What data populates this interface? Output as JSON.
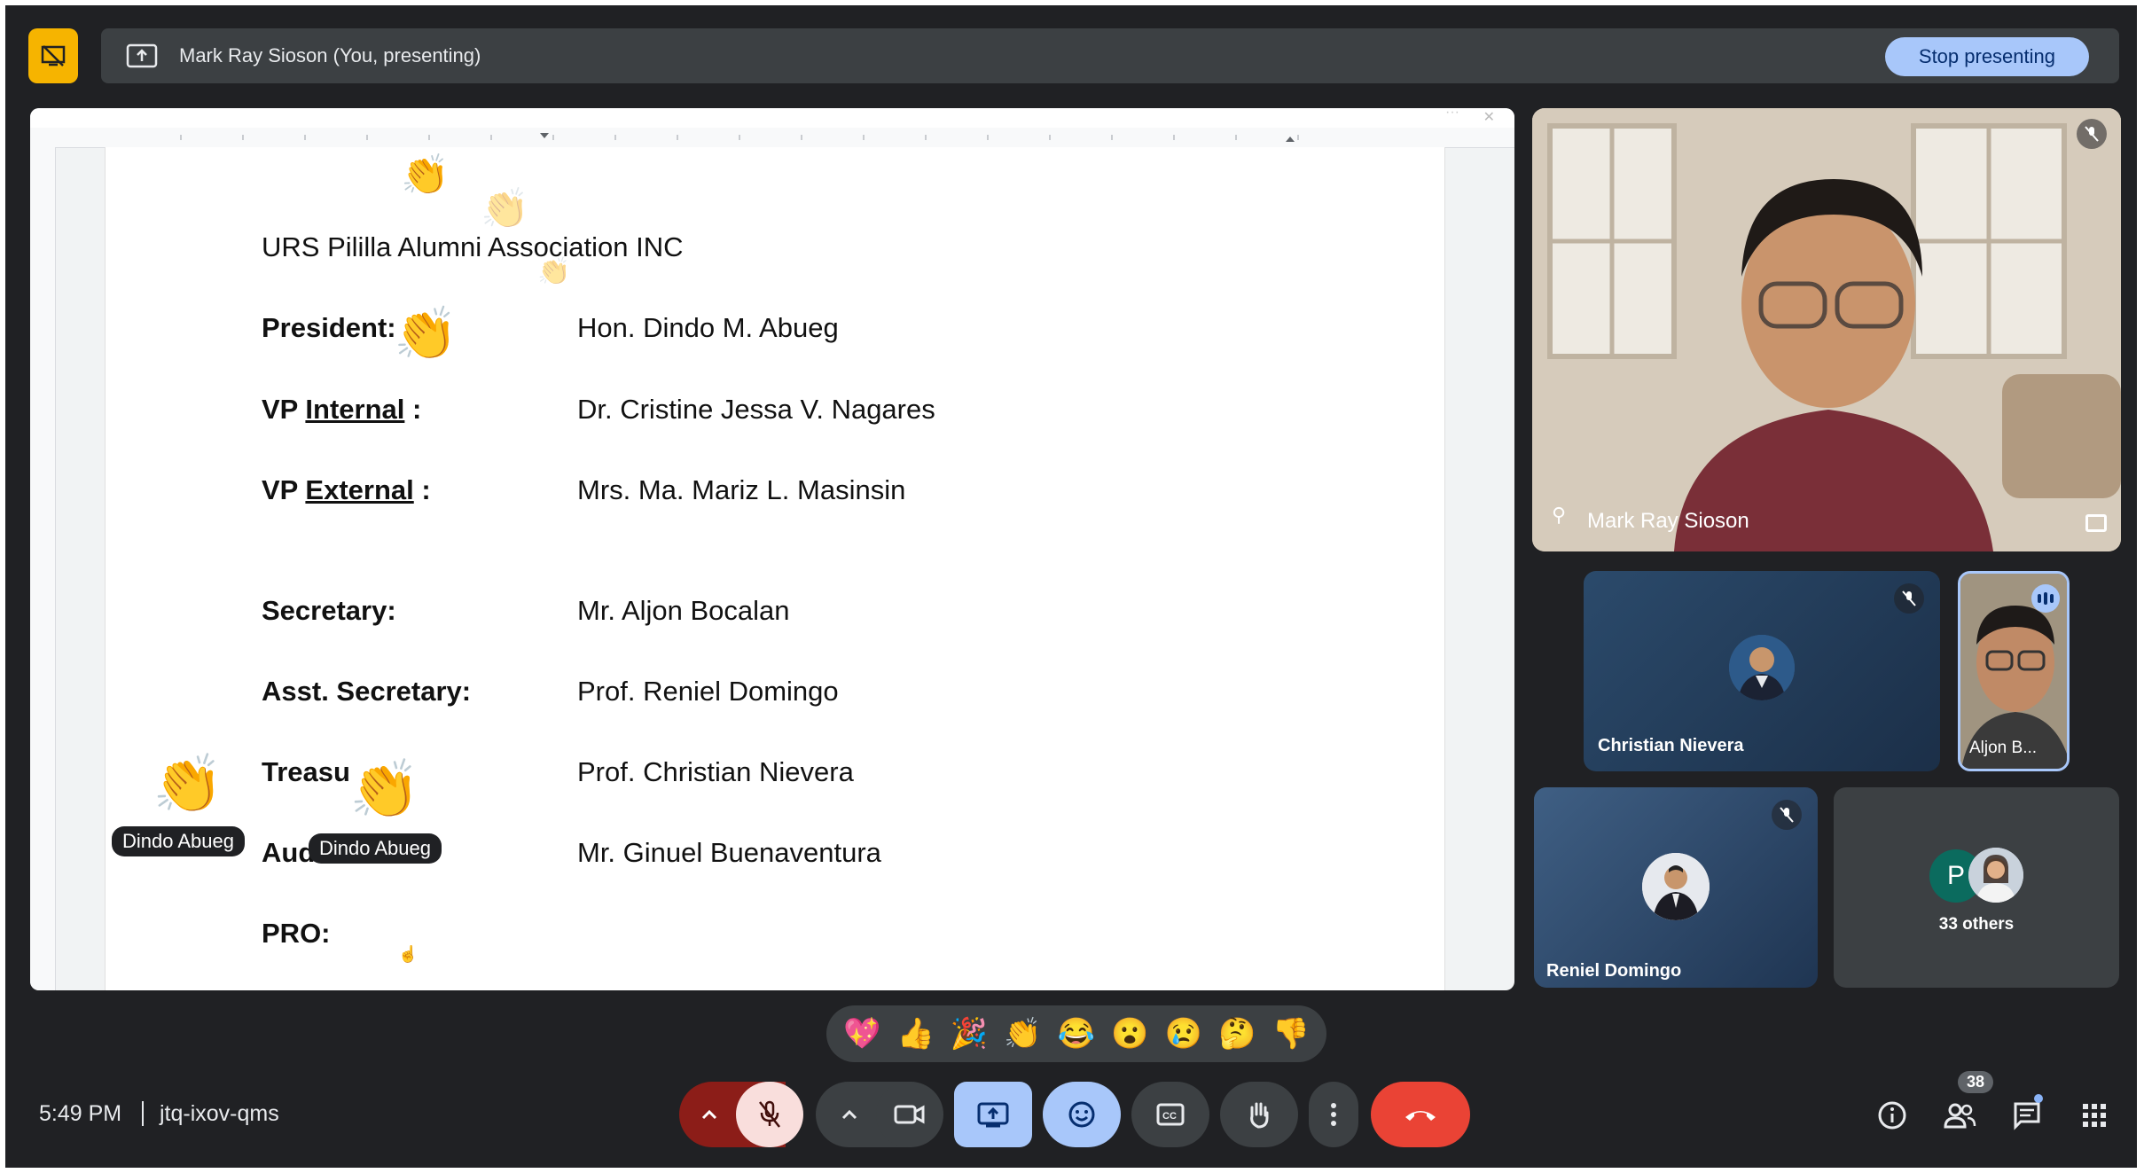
{
  "presenting_bar": {
    "presenter_text": "Mark Ray Sioson (You, presenting)",
    "stop_button_label": "Stop presenting"
  },
  "document": {
    "title": "URS Pililla Alumni Association INC",
    "roles": [
      {
        "label_prefix": "President:",
        "label_ul": "",
        "label_suffix": "",
        "value": "Hon. Dindo M. Abueg"
      },
      {
        "label_prefix": "VP ",
        "label_ul": "Internal",
        "label_suffix": " :",
        "value": "Dr. Cristine Jessa V. Nagares"
      },
      {
        "label_prefix": "VP ",
        "label_ul": "External",
        "label_suffix": " :",
        "value": "Mrs. Ma. Mariz L. Masinsin"
      },
      {
        "label_prefix": "Secretary:",
        "label_ul": "",
        "label_suffix": "",
        "value": "Mr. Aljon Bocalan"
      },
      {
        "label_prefix": "Asst. Secretary:",
        "label_ul": "",
        "label_suffix": "",
        "value": "Prof. Reniel Domingo"
      },
      {
        "label_prefix": "Treasu",
        "label_ul": "",
        "label_suffix": "",
        "value": "Prof. Christian Nievera"
      },
      {
        "label_prefix": "Auditor:",
        "label_ul": "",
        "label_suffix": "",
        "value": "Mr. Ginuel Buenaventura"
      },
      {
        "label_prefix": "PRO:",
        "label_ul": "",
        "label_suffix": "",
        "value": ""
      }
    ]
  },
  "floating_reactions": {
    "tag_1": "Dindo Abueg",
    "tag_2": "Dindo Abueg"
  },
  "participants": {
    "main_tile_name": "Mark Ray Sioson",
    "tile_christian": "Christian Nievera",
    "tile_aljon": "Aljon B...",
    "tile_reniel": "Reniel Domingo",
    "others_initial": "P",
    "others_label": "33 others"
  },
  "reaction_bar": [
    "💖",
    "👍",
    "🎉",
    "👏",
    "😂",
    "😮",
    "😢",
    "🤔",
    "👎"
  ],
  "bottom_bar": {
    "time": "5:49 PM",
    "meeting_code": "jtq-ixov-qms",
    "people_count": "38"
  },
  "colors": {
    "background": "#202124",
    "panel": "#3c4043",
    "accent_blue": "#a8c7fa",
    "end_call_red": "#ea4335",
    "mic_off_pink": "#f9dedc",
    "presenting_yellow": "#f6b400"
  },
  "icons": [
    "present-off-icon",
    "present-to-all-icon",
    "mic-off-icon",
    "videocam-icon",
    "present-icon",
    "emoji-icon",
    "captions-icon",
    "hand-icon",
    "more-vert-icon",
    "call-end-icon",
    "info-icon",
    "people-icon",
    "chat-icon",
    "apps-icon"
  ]
}
